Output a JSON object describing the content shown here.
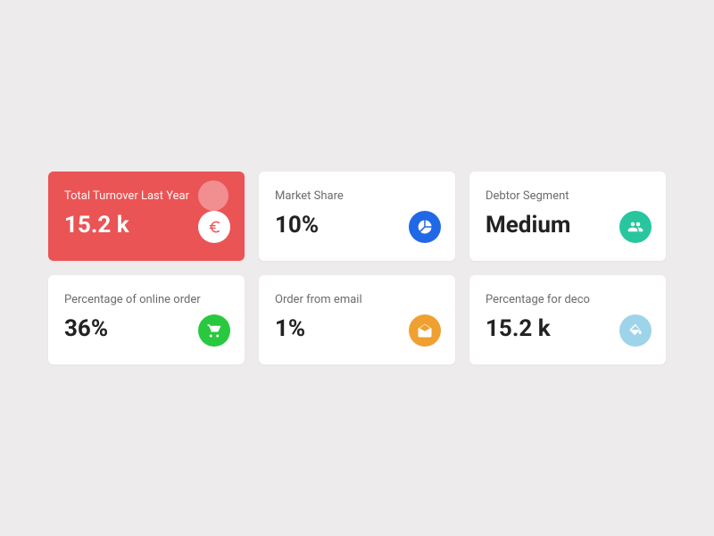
{
  "cards": [
    {
      "label": "Total Turnover Last Year",
      "value": "15.2 k"
    },
    {
      "label": "Market Share",
      "value": "10%"
    },
    {
      "label": "Debtor Segment",
      "value": "Medium"
    },
    {
      "label": "Percentage of online order",
      "value": "36%"
    },
    {
      "label": "Order from email",
      "value": "1%"
    },
    {
      "label": "Percentage for deco",
      "value": "15.2 k"
    }
  ],
  "colors": {
    "card_active_bg": "#ea5455",
    "icon_blue": "#2168e6",
    "icon_teal": "#28c69f",
    "icon_green": "#28c83f",
    "icon_orange": "#f0a030",
    "icon_lightblue": "#9ed4ea"
  }
}
